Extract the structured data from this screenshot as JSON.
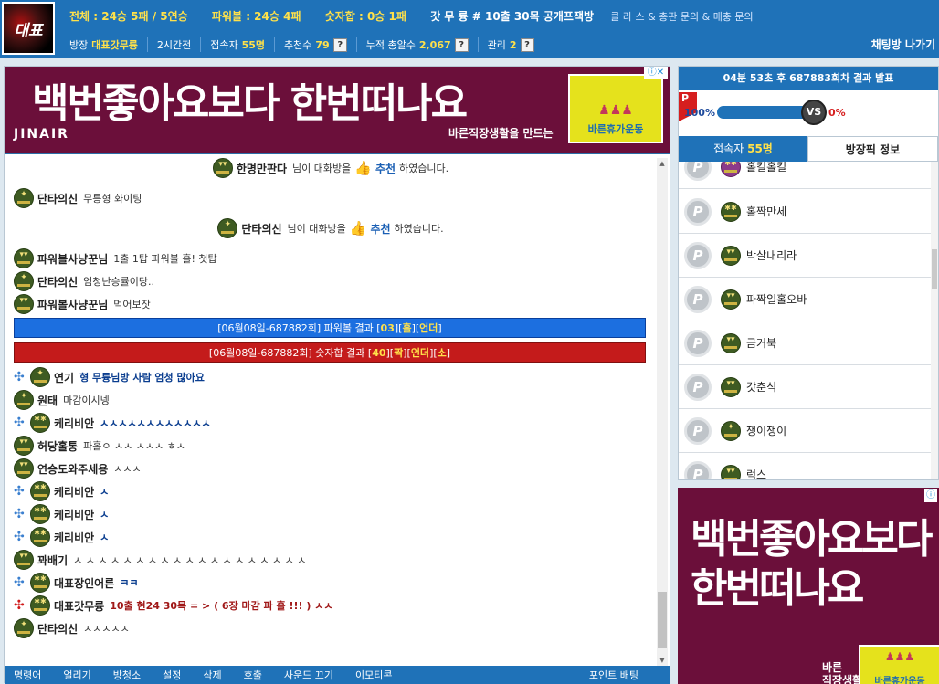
{
  "header": {
    "logo_text": "대표",
    "stats": {
      "total": "전체 : 24승 5패 / 5연승",
      "powerball": "파워볼 : 24승 4패",
      "sum": "숫자합 : 0승 1패"
    },
    "room_title": "갓 무 륭 # 10출 30목 공개프잭방",
    "inquiry": "클 라 스 & 총판 문의 & 매충 문의",
    "owner_label": "방장",
    "owner_name": "대표갓무륭",
    "elapsed": "2시간전",
    "users_label": "접속자",
    "users_value": "55명",
    "recommend_label": "추천수",
    "recommend_value": "79",
    "hits_label": "누적 총알수",
    "hits_value": "2,067",
    "manage_label": "관리",
    "manage_value": "2",
    "help_mark": "?",
    "exit_label": "채팅방 나가기"
  },
  "ads": {
    "top_main": "백번좋아요보다 한번떠나요",
    "top_brand": "JINAIR",
    "top_sub": "바른직장생활을 만드는",
    "campaign": "바른휴가운동",
    "choice": "ⓘ✕",
    "side_main_line1": "백번좋아요보다",
    "side_main_line2": "한번떠나요",
    "side_sub_line1": "바른",
    "side_sub_line2": "직장생활을",
    "side_campaign": "바른휴가운동",
    "side_choice": "ⓘ"
  },
  "chat": {
    "messages": [
      {
        "nick": "한명만판다",
        "text": "님이 대화방을",
        "rec": "추천",
        "tail": "하였습니다."
      },
      {
        "nick": "단타의신",
        "text": "무릉형 화이팅"
      },
      {
        "nick": "단타의신",
        "text": "님이 대화방을",
        "rec": "추천",
        "tail": "하였습니다."
      },
      {
        "nick": "파워볼사냥꾼님",
        "text": "1출 1탑 파워볼 홀! 첫탑"
      },
      {
        "nick": "단타의신",
        "text": "엄청난승률이당.."
      },
      {
        "nick": "파워볼사냥꾼님",
        "text": "먹어보잣"
      },
      {
        "nick": "연기",
        "text": "형 무륭님방 사람 엄청 많아요"
      },
      {
        "nick": "원태",
        "text": "마감이시넹"
      },
      {
        "nick": "케리비안",
        "text": "ㅅㅅㅅㅅㅅㅅㅅㅅㅅㅅㅅㅅ"
      },
      {
        "nick": "허당홀통",
        "text": "파홀ㅇ ㅅㅅ ㅅㅅㅅ ㅎㅅ"
      },
      {
        "nick": "연승도와주세용",
        "text": "ㅅㅅㅅ"
      },
      {
        "nick": "케리비안",
        "text": "ㅅ"
      },
      {
        "nick": "케리비안",
        "text": "ㅅ"
      },
      {
        "nick": "케리비안",
        "text": "ㅅ"
      },
      {
        "nick": "꽈배기",
        "text": "ㅅ ㅅ ㅅ ㅅ ㅅ ㅅ  ㅅ ㅅ ㅅ ㅅ ㅅ ㅅ  ㅅ ㅅ ㅅ ㅅ ㅅ ㅅ  ㅅ"
      },
      {
        "nick": "대표장인어른",
        "text": "ㅋㅋ"
      },
      {
        "nick": "대표갓무륭",
        "text": "10출 현24  30목 = >  ( 6장 마감 파 홀 !!! )  ㅅㅅ"
      },
      {
        "nick": "단타의신",
        "text": "ㅅㅅㅅㅅㅅ"
      }
    ],
    "notice_blue": {
      "prefix": "[06월08일-687882회] 파워볼 결과 [",
      "num": "03",
      "mid1": "][",
      "v1": "홀",
      "mid2": "][",
      "v2": "언더",
      "suffix": "]"
    },
    "notice_red": {
      "prefix": "[06월08일-687882회] 숫자합 결과 [",
      "num": "40",
      "mid1": "][",
      "v1": "짝",
      "mid2": "][",
      "v2": "언더",
      "mid3": "][",
      "v3": "소",
      "suffix": "]"
    }
  },
  "bottom_menu": [
    "명령어",
    "얼리기",
    "방청소",
    "설정",
    "삭제",
    "호출",
    "사운드 끄기",
    "이모티콘"
  ],
  "bottom_right": "포인트 배팅",
  "side": {
    "result_header": "04분 53초 후 687883회차 결과 발표",
    "pflag": "P",
    "left_pct": "100%",
    "right_pct": "0%",
    "vs": "VS",
    "tab_users_label": "접속자",
    "tab_users_value": "55명",
    "tab_info": "방장픽 정보",
    "users": [
      {
        "name": "홀킬홀킬",
        "badge": "P"
      },
      {
        "name": "홀짝만세",
        "badge": "P"
      },
      {
        "name": "박살내리라",
        "badge": "P"
      },
      {
        "name": "파짝일홀오바",
        "badge": "P"
      },
      {
        "name": "금거북",
        "badge": "P"
      },
      {
        "name": "갓춘식",
        "badge": "P"
      },
      {
        "name": "쟁이쟁이",
        "badge": "P"
      },
      {
        "name": "럭스",
        "badge": "P"
      }
    ]
  },
  "colors": {
    "accent": "#1f72b8",
    "highlight": "#ffe14a",
    "ad_bg": "#6b0f3a",
    "notice_blue": "#1c6fe0",
    "notice_red": "#c41b1b"
  },
  "bar_fill_percent": 100
}
